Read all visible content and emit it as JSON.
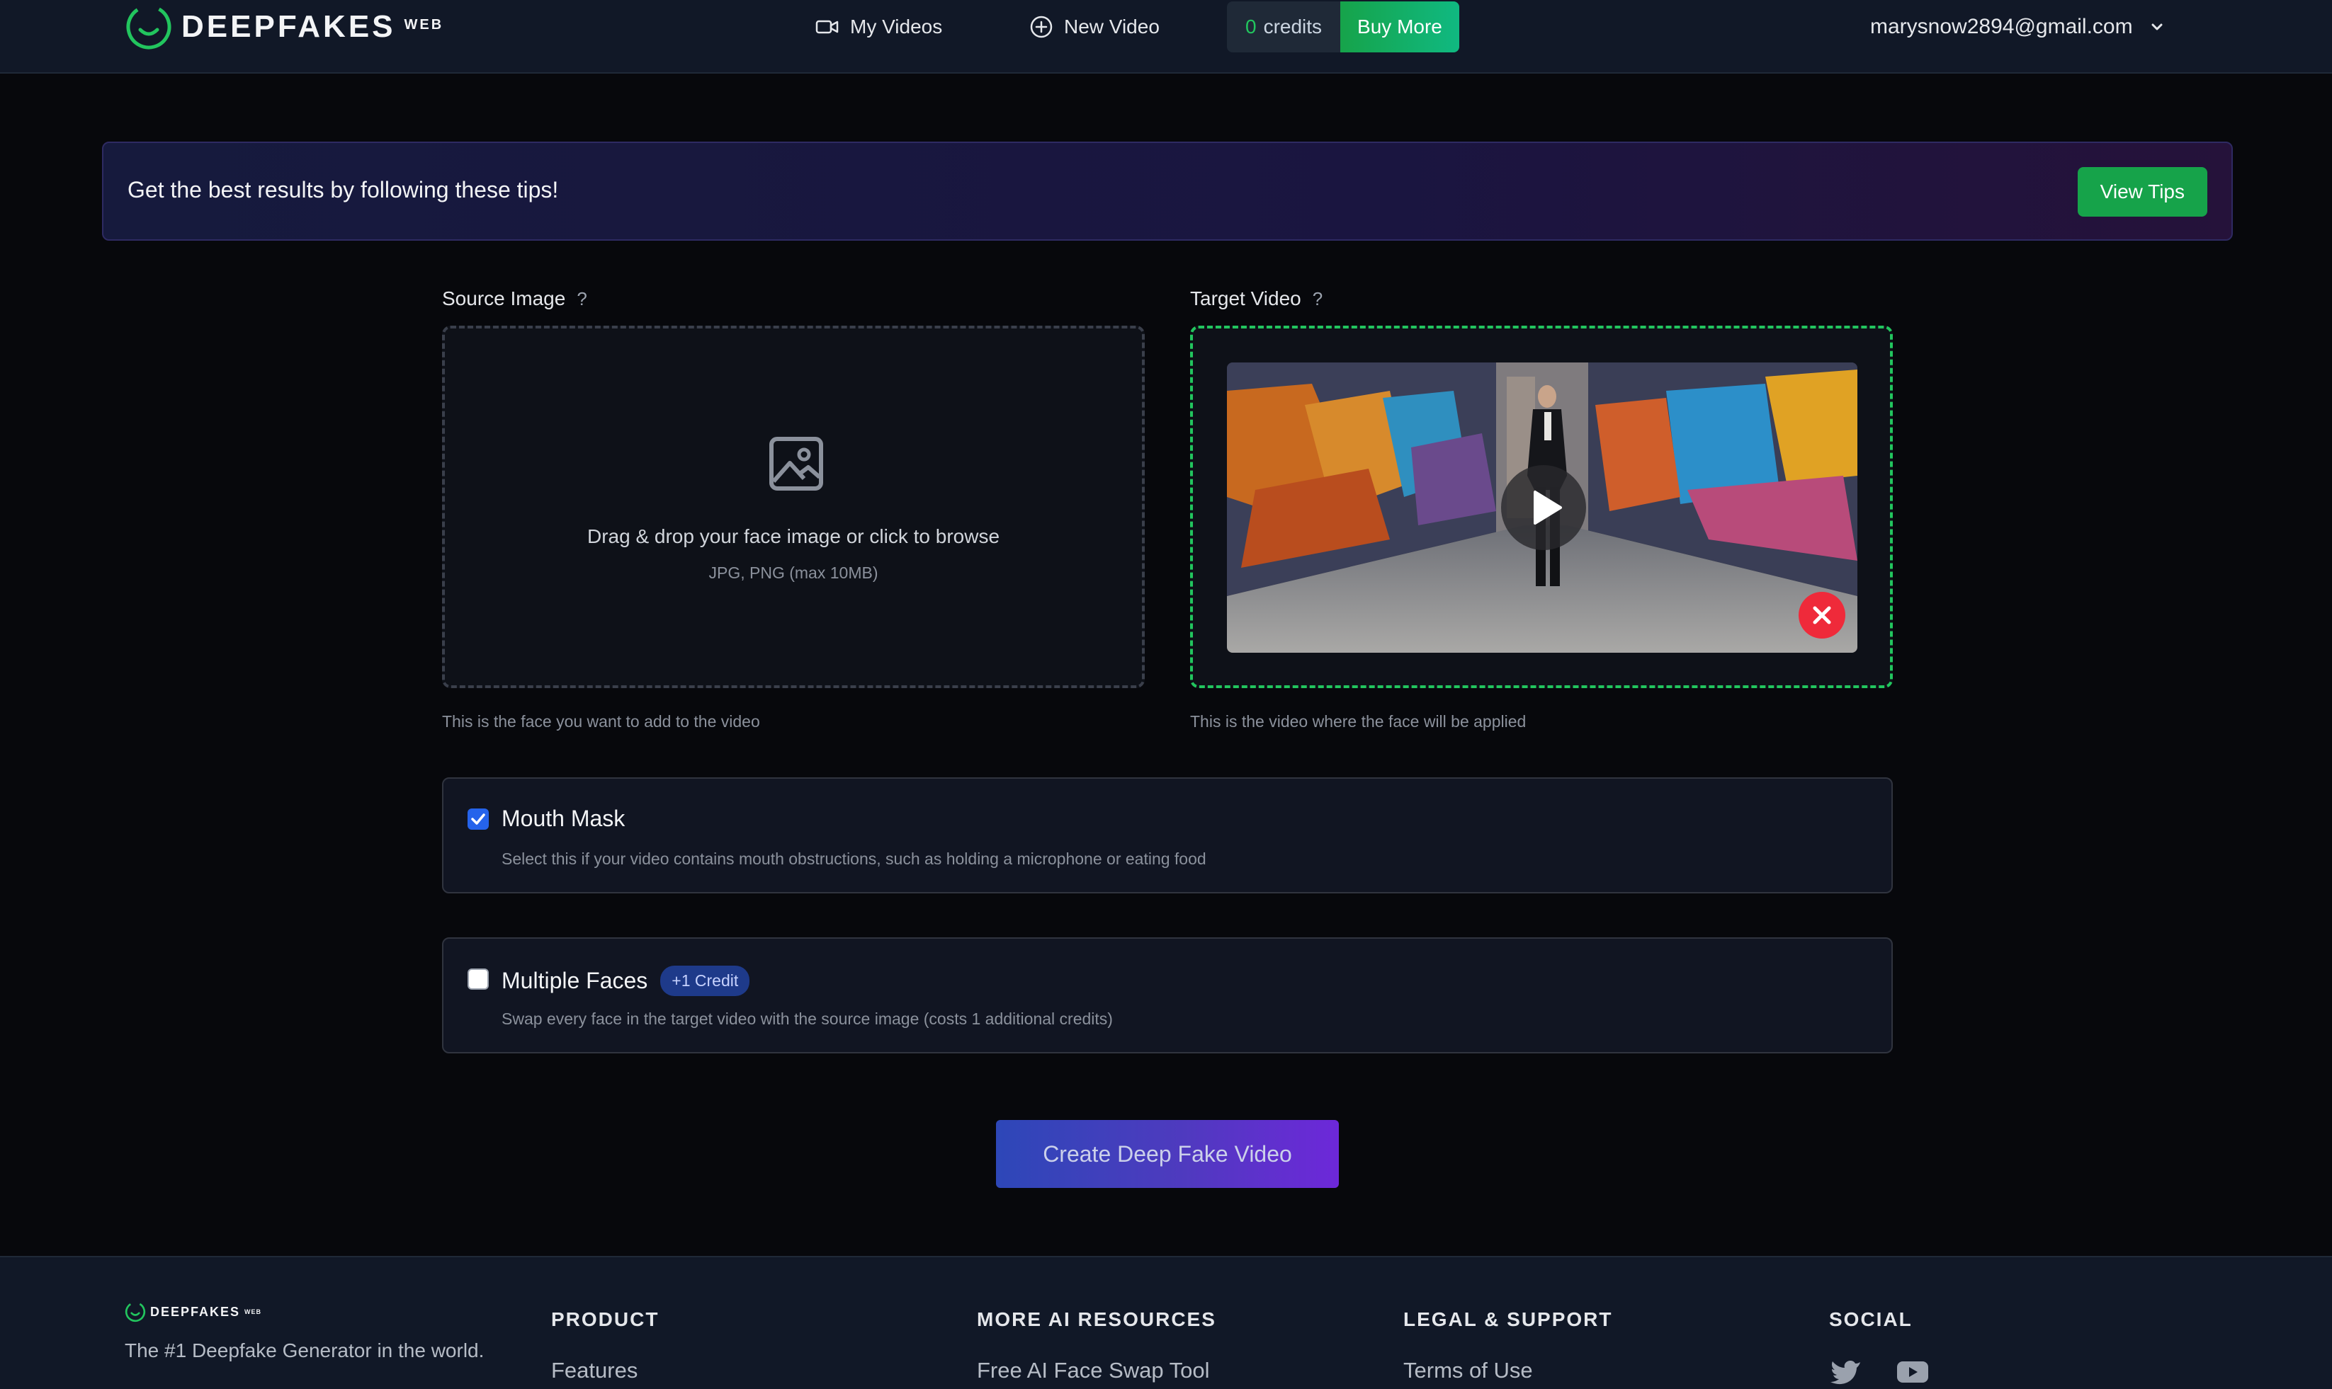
{
  "header": {
    "logo_text": "DEEPFAKES",
    "logo_sub": "WEB",
    "nav": {
      "my_videos": "My Videos",
      "new_video": "New Video"
    },
    "credits_count": "0",
    "credits_label": "credits",
    "buy_more": "Buy More",
    "user_email": "marysnow2894@gmail.com"
  },
  "tips": {
    "text": "Get the best results by following these tips!",
    "button": "View Tips"
  },
  "source": {
    "label": "Source Image",
    "help_mark": "?",
    "drop_text": "Drag & drop your face image or click to browse",
    "formats": "JPG, PNG (max 10MB)",
    "help": "This is the face you want to add to the video"
  },
  "target": {
    "label": "Target Video",
    "help_mark": "?",
    "help": "This is the video where the face will be applied"
  },
  "options": {
    "mouth_mask": {
      "title": "Mouth Mask",
      "checked": true,
      "desc": "Select this if your video contains mouth obstructions, such as holding a microphone or eating food"
    },
    "multiple_faces": {
      "title": "Multiple Faces",
      "badge": "+1 Credit",
      "checked": false,
      "desc": "Swap every face in the target video with the source image (costs 1 additional credits)"
    }
  },
  "create_button": "Create Deep Fake Video",
  "footer": {
    "logo_text": "DEEPFAKES",
    "logo_sub": "WEB",
    "tagline": "The #1 Deepfake Generator in the world.",
    "columns": [
      {
        "heading": "PRODUCT",
        "link": "Features"
      },
      {
        "heading": "MORE AI RESOURCES",
        "link": "Free AI Face Swap Tool"
      },
      {
        "heading": "LEGAL & SUPPORT",
        "link": "Terms of Use"
      },
      {
        "heading": "SOCIAL"
      }
    ],
    "social_icons": [
      "twitter-icon",
      "youtube-icon"
    ]
  },
  "colors": {
    "accent_green": "#22c55e",
    "danger": "#ef2a3a",
    "checkbox_blue": "#2563eb"
  }
}
